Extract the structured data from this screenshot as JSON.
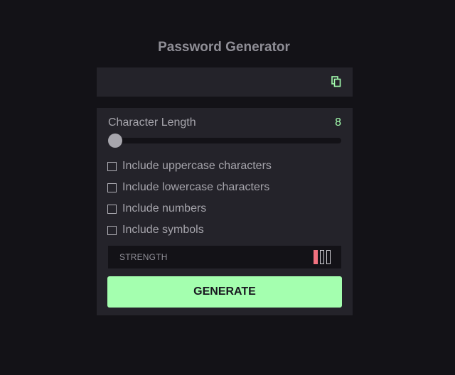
{
  "app": {
    "title": "Password Generator"
  },
  "output": {
    "password": "",
    "copy_icon": "copy-icon"
  },
  "settings": {
    "length_label": "Character Length",
    "length_value": "8",
    "slider": {
      "min": 0,
      "max": 20,
      "value": 8
    },
    "options": [
      {
        "label": "Include uppercase characters",
        "checked": false
      },
      {
        "label": "Include lowercase characters",
        "checked": false
      },
      {
        "label": "Include numbers",
        "checked": false
      },
      {
        "label": "Include symbols",
        "checked": false
      }
    ]
  },
  "strength": {
    "label": "STRENGTH",
    "level": 1,
    "max_level": 3
  },
  "generate": {
    "label": "GENERATE"
  },
  "colors": {
    "background": "#131217",
    "panel": "#24232a",
    "accent": "#a4ffaf",
    "strength_bar": "#f1717f"
  }
}
